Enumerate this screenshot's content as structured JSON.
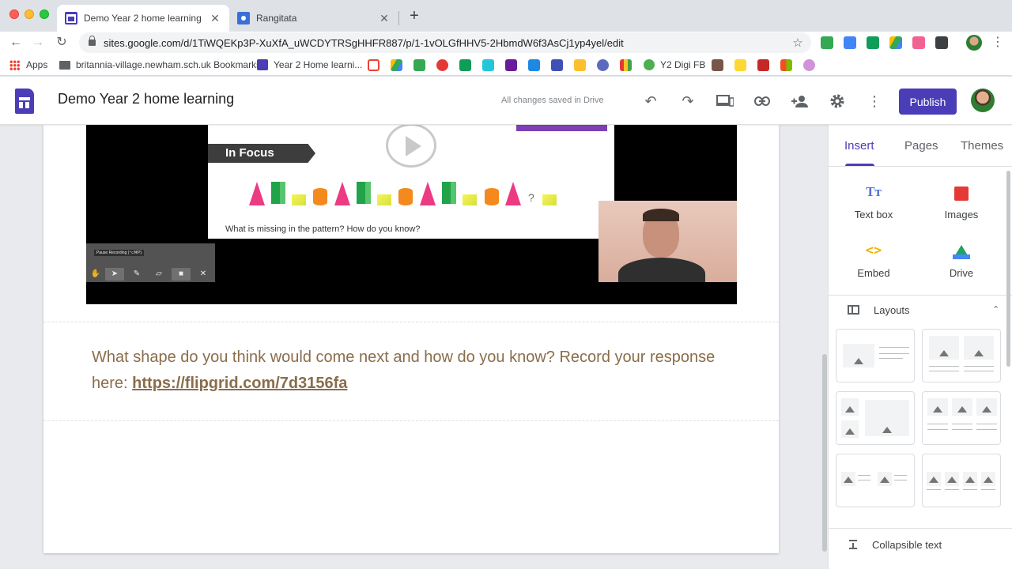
{
  "browser": {
    "tabs": [
      {
        "title": "Demo Year 2 home learning",
        "active": true
      },
      {
        "title": "Rangitata",
        "active": false
      }
    ],
    "url": "sites.google.com/d/1TiWQEKp3P-XuXfA_uWCDYTRSgHHFR887/p/1-1vOLGfHHV5-2HbmdW6f3AsCj1yp4yel/edit",
    "bookmarks": [
      {
        "label": "Apps"
      },
      {
        "label": "britannia-village.newham.sch.uk Bookmarks"
      },
      {
        "label": "Year 2 Home learni..."
      },
      {
        "label": "Y2 Digi FB"
      }
    ]
  },
  "sites_header": {
    "title": "Demo Year 2 home learning",
    "status": "All changes saved in Drive",
    "publish_label": "Publish"
  },
  "video": {
    "banner": "In Focus",
    "question": "What is missing in the pattern? How do you know?",
    "question_mark": "?",
    "recording_tooltip": "Pause Recording (⌥⌘P)"
  },
  "content": {
    "paragraph": "What shape do you think would come next and how do you know? Record your response here: ",
    "link": "https://flipgrid.com/7d3156fa"
  },
  "panel": {
    "tabs": [
      "Insert",
      "Pages",
      "Themes"
    ],
    "insert_items": [
      "Text box",
      "Images",
      "Embed",
      "Drive"
    ],
    "layouts_label": "Layouts",
    "collapsible_label": "Collapsible text"
  },
  "colors": {
    "accent": "#4b3db8",
    "text_brown": "#8a6d4a"
  }
}
